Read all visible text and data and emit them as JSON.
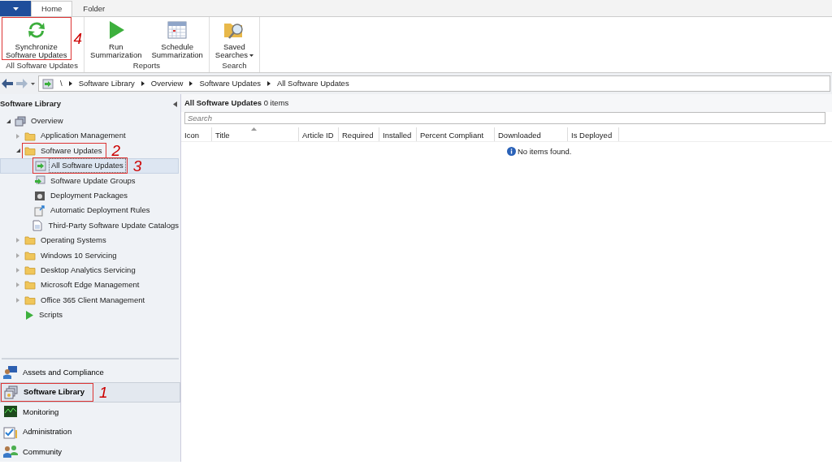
{
  "ribbon": {
    "tabs": [
      {
        "label": "Home",
        "selected": true
      },
      {
        "label": "Folder",
        "selected": false
      }
    ],
    "groups": [
      {
        "label": "All Software Updates",
        "buttons": [
          {
            "kind": "sync",
            "lines": [
              "Synchronize",
              "Software Updates"
            ],
            "callout": "4"
          }
        ]
      },
      {
        "label": "Reports",
        "buttons": [
          {
            "kind": "run",
            "lines": [
              "Run",
              "Summarization"
            ]
          },
          {
            "kind": "schedule",
            "lines": [
              "Schedule",
              "Summarization"
            ]
          }
        ]
      },
      {
        "label": "Search",
        "buttons": [
          {
            "kind": "saved",
            "lines": [
              "Saved",
              "Searches"
            ],
            "dropdown": true
          }
        ]
      }
    ]
  },
  "breadcrumb": [
    "\\",
    "Software Library",
    "Overview",
    "Software Updates",
    "All Software Updates"
  ],
  "navigation_pane": {
    "title": "Software Library",
    "tree": [
      {
        "kind": "overview",
        "label": "Overview",
        "expanded": true,
        "selected": false,
        "children": [
          {
            "kind": "folder",
            "label": "Application Management",
            "expanded": false,
            "selected": false
          },
          {
            "kind": "folder",
            "label": "Software Updates",
            "expanded": true,
            "selected": false,
            "callout": "2",
            "children": [
              {
                "kind": "update",
                "label": "All Software Updates",
                "selected": true,
                "callout": "3"
              },
              {
                "kind": "group",
                "label": "Software Update Groups",
                "selected": false
              },
              {
                "kind": "package",
                "label": "Deployment Packages",
                "selected": false
              },
              {
                "kind": "rule",
                "label": "Automatic Deployment Rules",
                "selected": false
              },
              {
                "kind": "catalog",
                "label": "Third-Party Software Update Catalogs",
                "selected": false
              }
            ]
          },
          {
            "kind": "folder",
            "label": "Operating Systems",
            "expanded": false,
            "selected": false
          },
          {
            "kind": "folder",
            "label": "Windows 10 Servicing",
            "expanded": false,
            "selected": false
          },
          {
            "kind": "folder",
            "label": "Desktop Analytics Servicing",
            "expanded": false,
            "selected": false
          },
          {
            "kind": "folder",
            "label": "Microsoft Edge Management",
            "expanded": false,
            "selected": false
          },
          {
            "kind": "folder",
            "label": "Office 365 Client Management",
            "expanded": false,
            "selected": false
          },
          {
            "kind": "script",
            "label": "Scripts",
            "selected": false
          }
        ]
      }
    ],
    "workspaces": [
      {
        "kind": "assets",
        "label": "Assets and Compliance",
        "selected": false
      },
      {
        "kind": "library",
        "label": "Software Library",
        "selected": true,
        "callout": "1"
      },
      {
        "kind": "monitoring",
        "label": "Monitoring",
        "selected": false
      },
      {
        "kind": "admin",
        "label": "Administration",
        "selected": false
      },
      {
        "kind": "community",
        "label": "Community",
        "selected": false
      }
    ]
  },
  "content": {
    "heading": "**All Software Updates** 0 items",
    "search": {
      "placeholder": "Search"
    },
    "columns": [
      {
        "label": "Icon",
        "sorted": false
      },
      {
        "label": "Title",
        "sorted": true
      },
      {
        "label": "Article ID",
        "sorted": false
      },
      {
        "label": "Required",
        "sorted": false
      },
      {
        "label": "Installed",
        "sorted": false
      },
      {
        "label": "Percent Compliant",
        "sorted": false
      },
      {
        "label": "Downloaded",
        "sorted": false
      },
      {
        "label": "Is Deployed",
        "sorted": false
      }
    ],
    "empty_message": "No items found."
  }
}
